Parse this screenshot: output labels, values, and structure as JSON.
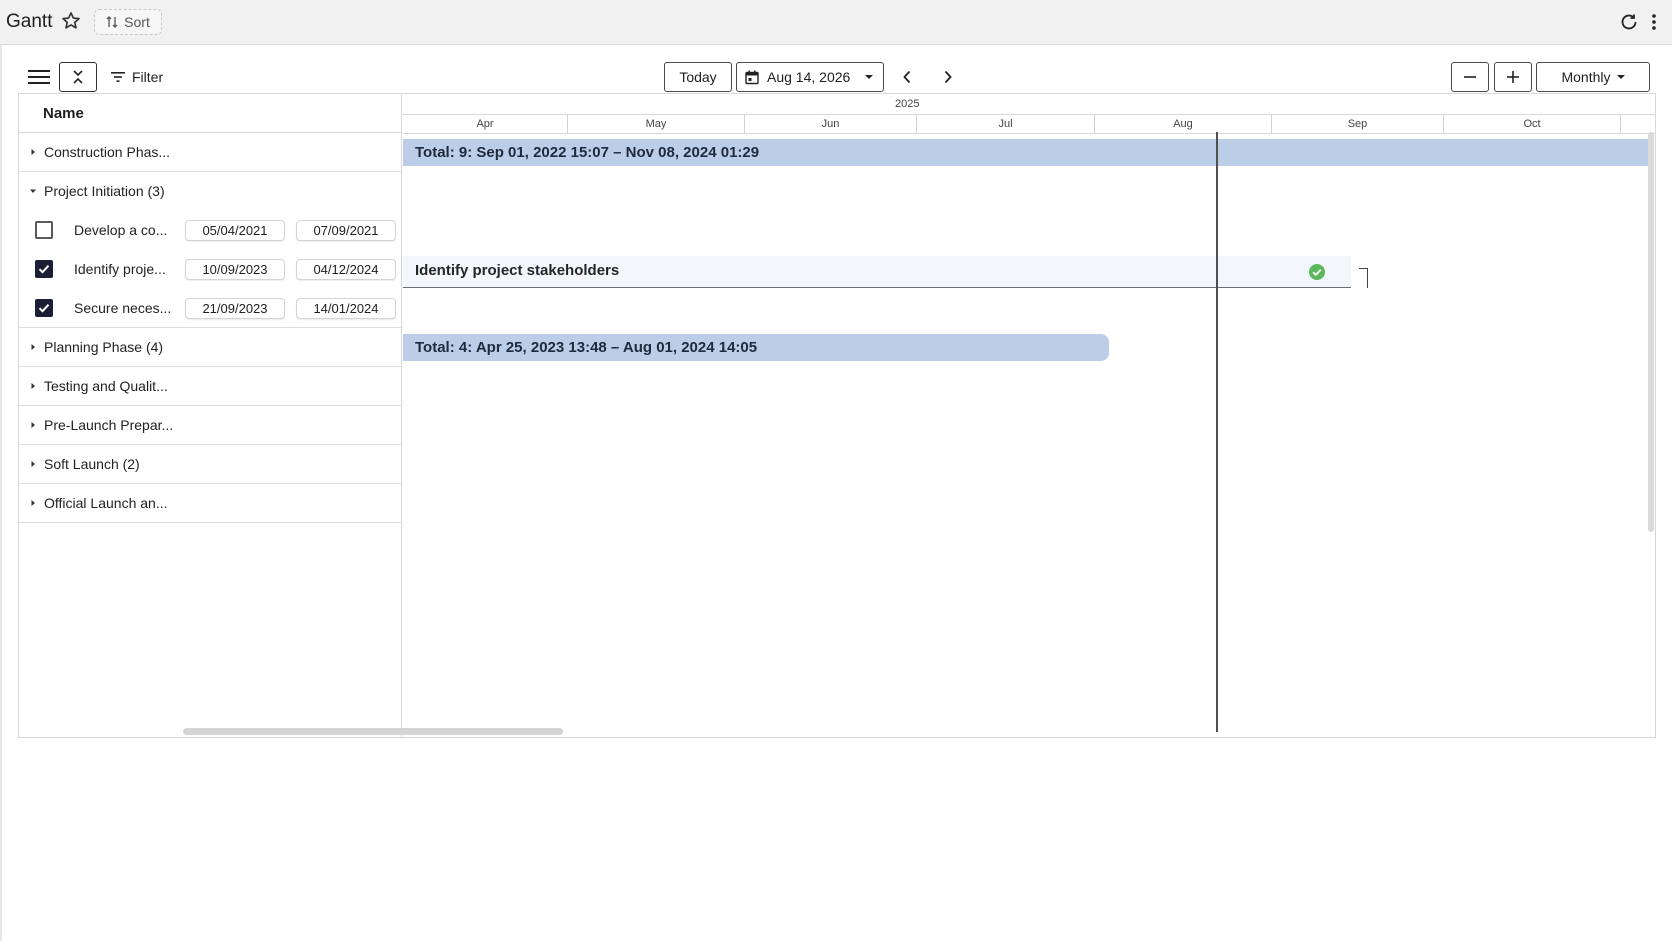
{
  "window": {
    "title": "Gantt",
    "sort_label": "Sort"
  },
  "toolbar": {
    "filter_label": "Filter",
    "today_label": "Today",
    "date_value": "Aug 14, 2026",
    "view_label": "Monthly"
  },
  "grid": {
    "header_name": "Name",
    "rows": [
      {
        "label": "Construction Phas...",
        "expanded": false
      },
      {
        "label": "Project Initiation (3)",
        "expanded": true
      },
      {
        "label": "Develop a co...",
        "checked": false,
        "start": "05/04/2021",
        "end": "07/09/2021"
      },
      {
        "label": "Identify proje...",
        "checked": true,
        "start": "10/09/2023",
        "end": "04/12/2024"
      },
      {
        "label": "Secure neces...",
        "checked": true,
        "start": "21/09/2023",
        "end": "14/01/2024"
      },
      {
        "label": "Planning Phase (4)",
        "expanded": false
      },
      {
        "label": "Testing and Qualit...",
        "expanded": false
      },
      {
        "label": "Pre-Launch Prepar...",
        "expanded": false
      },
      {
        "label": "Soft Launch (2)",
        "expanded": false
      },
      {
        "label": "Official Launch an...",
        "expanded": false
      }
    ]
  },
  "timeline": {
    "year": "2025",
    "months": [
      "Apr",
      "May",
      "Jun",
      "Jul",
      "Aug",
      "Sep",
      "Oct"
    ],
    "summary_bars": [
      "Total: 9: Sep 01, 2022 15:07 – Nov 08, 2024 01:29",
      "Total: 4: Apr 25, 2023 13:48 – Aug 01, 2024 14:05"
    ],
    "task_bar_label": "Identify project stakeholders"
  },
  "colors": {
    "summary_bar": "#bccde8",
    "checkbox_checked": "#1a1f36",
    "complete_icon": "#5cb85c"
  },
  "icons": {
    "star": "star-icon",
    "sort": "sort-arrows-icon",
    "refresh": "refresh-icon",
    "more": "more-vertical-icon",
    "menu": "hamburger-menu-icon",
    "collapse": "collapse-icon",
    "filter": "filter-icon",
    "calendar": "calendar-icon",
    "complete": "check-circle-icon"
  }
}
